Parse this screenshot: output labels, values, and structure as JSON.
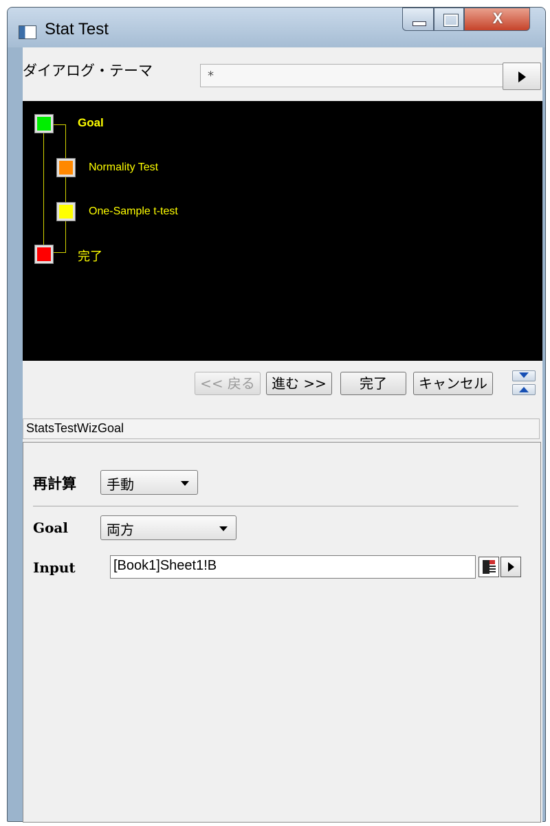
{
  "window": {
    "title": "Stat Test",
    "close_glyph": "X"
  },
  "theme": {
    "label": "ダイアログ・テーマ",
    "value": "*"
  },
  "tree": {
    "nodes": [
      {
        "label": "Goal",
        "color": "#00ee00"
      },
      {
        "label": "Normality Test",
        "color": "#ff8800"
      },
      {
        "label": "One-Sample t-test",
        "color": "#ffff00"
      },
      {
        "label": "完了",
        "color": "#ff0000"
      }
    ]
  },
  "nav": {
    "back": "<< 戻る",
    "next": "進む >>",
    "finish": "完了",
    "cancel": "キャンセル"
  },
  "tree_name": "StatsTestWizGoal",
  "settings": {
    "recalc_label": "再計算",
    "recalc_value": "手動",
    "goal_label": "Goal",
    "goal_value": "両方",
    "input_label": "Input",
    "input_value": "[Book1]Sheet1!B"
  },
  "icons": {
    "app": "dialog-app-icon",
    "theme_menu": "triangle-right-icon",
    "expand": "triangle-down-icon",
    "collapse": "triangle-up-icon",
    "range_select": "worksheet-select-icon",
    "range_menu": "triangle-right-icon"
  },
  "colors": {
    "tree_background": "#000000",
    "tree_text": "#ffff00",
    "close_button": "#c6432a"
  }
}
